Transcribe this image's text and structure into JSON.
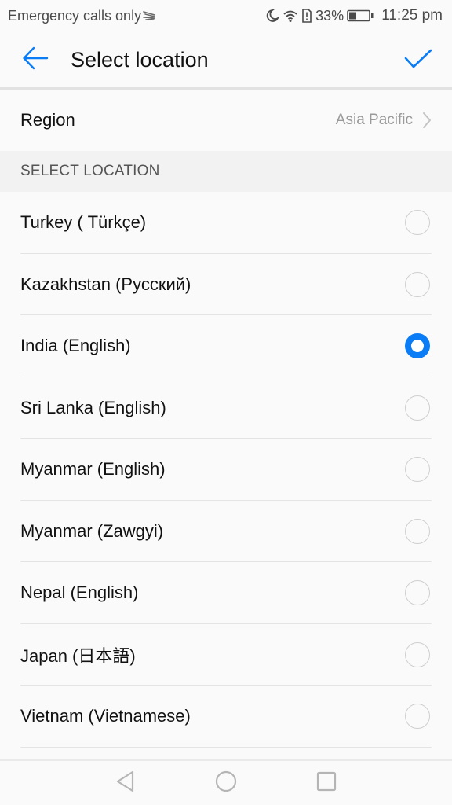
{
  "status_bar": {
    "carrier_text": "Emergency calls only",
    "battery_percent": "33%",
    "battery_level": 0.33,
    "time": "11:25 pm",
    "icons": [
      "signal-swipe-icon",
      "do-not-disturb-moon-icon",
      "wifi-icon",
      "sim-alert-icon",
      "battery-icon"
    ]
  },
  "app_bar": {
    "title": "Select location",
    "back_icon": "arrow-left-icon",
    "confirm_icon": "check-icon"
  },
  "region": {
    "label": "Region",
    "value": "Asia Pacific"
  },
  "section": {
    "header": "SELECT LOCATION"
  },
  "locations": [
    {
      "label": "Turkey ( Türkçe)",
      "selected": false
    },
    {
      "label": "Kazakhstan (Русский)",
      "selected": false
    },
    {
      "label": "India (English)",
      "selected": true
    },
    {
      "label": "Sri Lanka (English)",
      "selected": false
    },
    {
      "label": "Myanmar (English)",
      "selected": false
    },
    {
      "label": "Myanmar (Zawgyi)",
      "selected": false
    },
    {
      "label": "Nepal (English)",
      "selected": false
    },
    {
      "label": "Japan (日本語)",
      "selected": false
    },
    {
      "label": "Vietnam (Vietnamese)",
      "selected": false
    }
  ],
  "colors": {
    "accent": "#0a7cf5",
    "radio_unselected": "#cfcfcf",
    "secondary_text": "#9a9a9a"
  },
  "nav_bar": {
    "buttons": [
      "back-triangle-icon",
      "home-circle-icon",
      "recents-square-icon"
    ]
  }
}
